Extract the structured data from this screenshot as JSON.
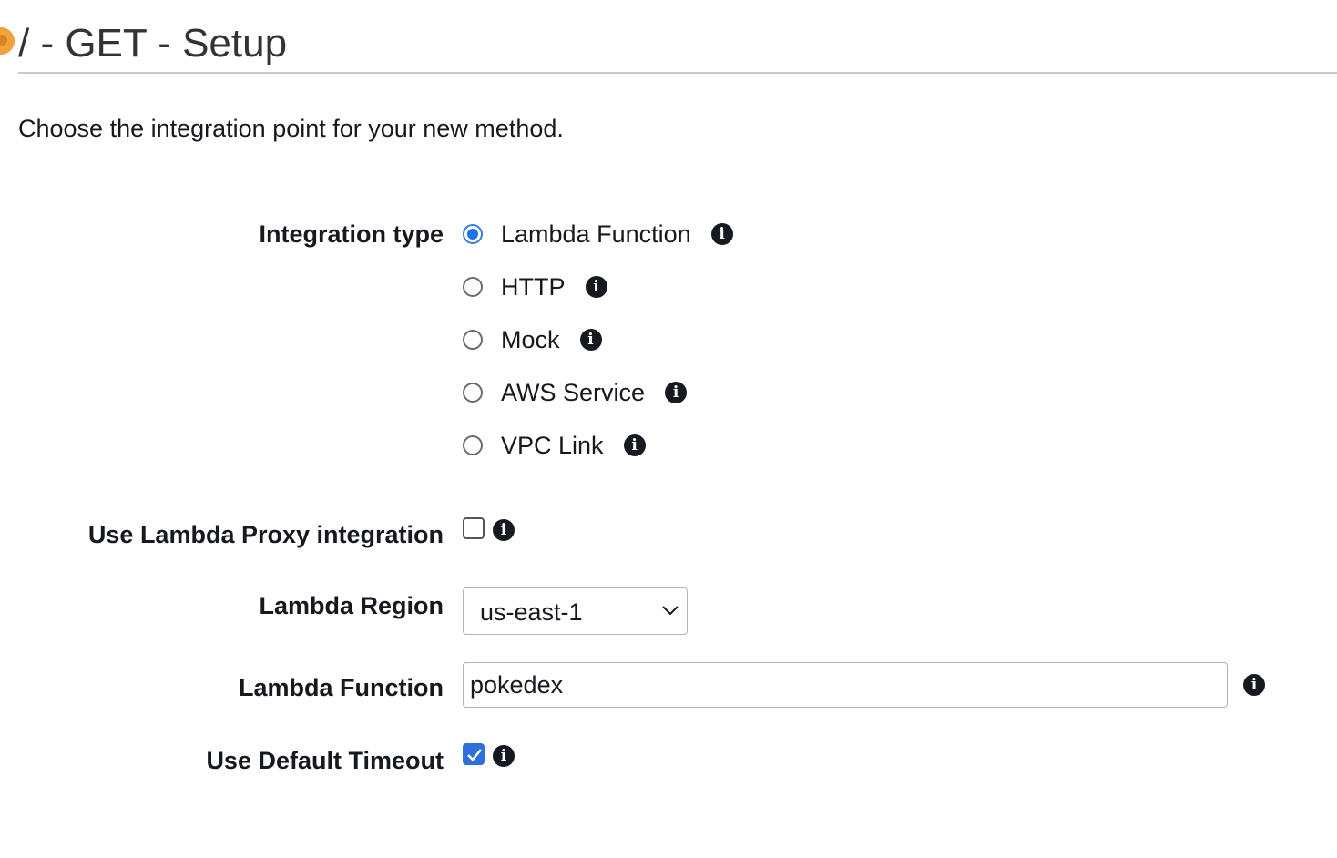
{
  "header": {
    "title": "/ - GET - Setup"
  },
  "intro": "Choose the integration point for your new method.",
  "form": {
    "integration_type": {
      "label": "Integration type",
      "options": [
        {
          "label": "Lambda Function",
          "selected": true
        },
        {
          "label": "HTTP",
          "selected": false
        },
        {
          "label": "Mock",
          "selected": false
        },
        {
          "label": "AWS Service",
          "selected": false
        },
        {
          "label": "VPC Link",
          "selected": false
        }
      ]
    },
    "lambda_proxy": {
      "label": "Use Lambda Proxy integration",
      "checked": false
    },
    "lambda_region": {
      "label": "Lambda Region",
      "value": "us-east-1"
    },
    "lambda_function": {
      "label": "Lambda Function",
      "value": "pokedex"
    },
    "default_timeout": {
      "label": "Use Default Timeout",
      "checked": true
    }
  },
  "colors": {
    "accent": "#2f6fdb",
    "radio_selected": "#1a73e8",
    "status_dot": "#f0a33c"
  },
  "icons": {
    "info": "info-circle-icon",
    "chevron": "chevron-down-icon",
    "check": "check-icon"
  }
}
